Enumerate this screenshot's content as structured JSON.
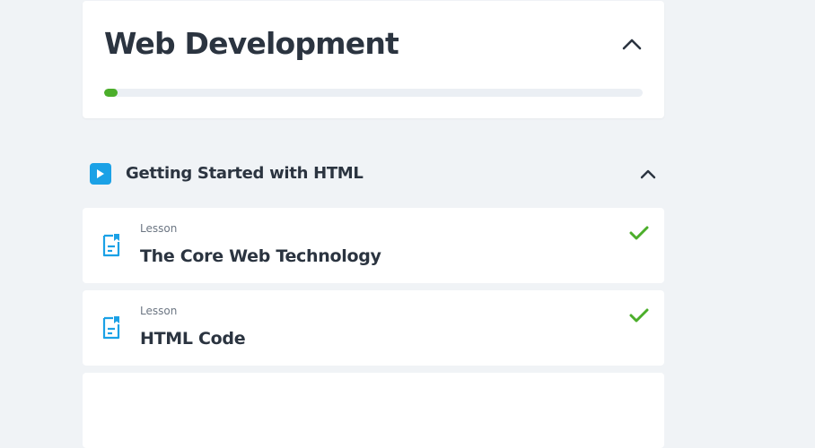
{
  "course": {
    "title": "Web Development",
    "progress": 0.025,
    "collapse_icon": "chevron-up-icon"
  },
  "section": {
    "title": "Getting Started with HTML",
    "icon": "play-icon",
    "collapse_icon": "chevron-up-icon"
  },
  "lessons": [
    {
      "type": "Lesson",
      "title": "The Core Web Technology",
      "completed": true,
      "icon": "lesson-document-icon"
    },
    {
      "type": "Lesson",
      "title": "HTML Code",
      "completed": true,
      "icon": "lesson-document-icon"
    }
  ],
  "colors": {
    "accent": "#1ba1e6",
    "progress": "#4bae2a",
    "check": "#4bae2a",
    "background": "#f0f3f6",
    "text": "#2b3440",
    "muted": "#6c7683"
  }
}
